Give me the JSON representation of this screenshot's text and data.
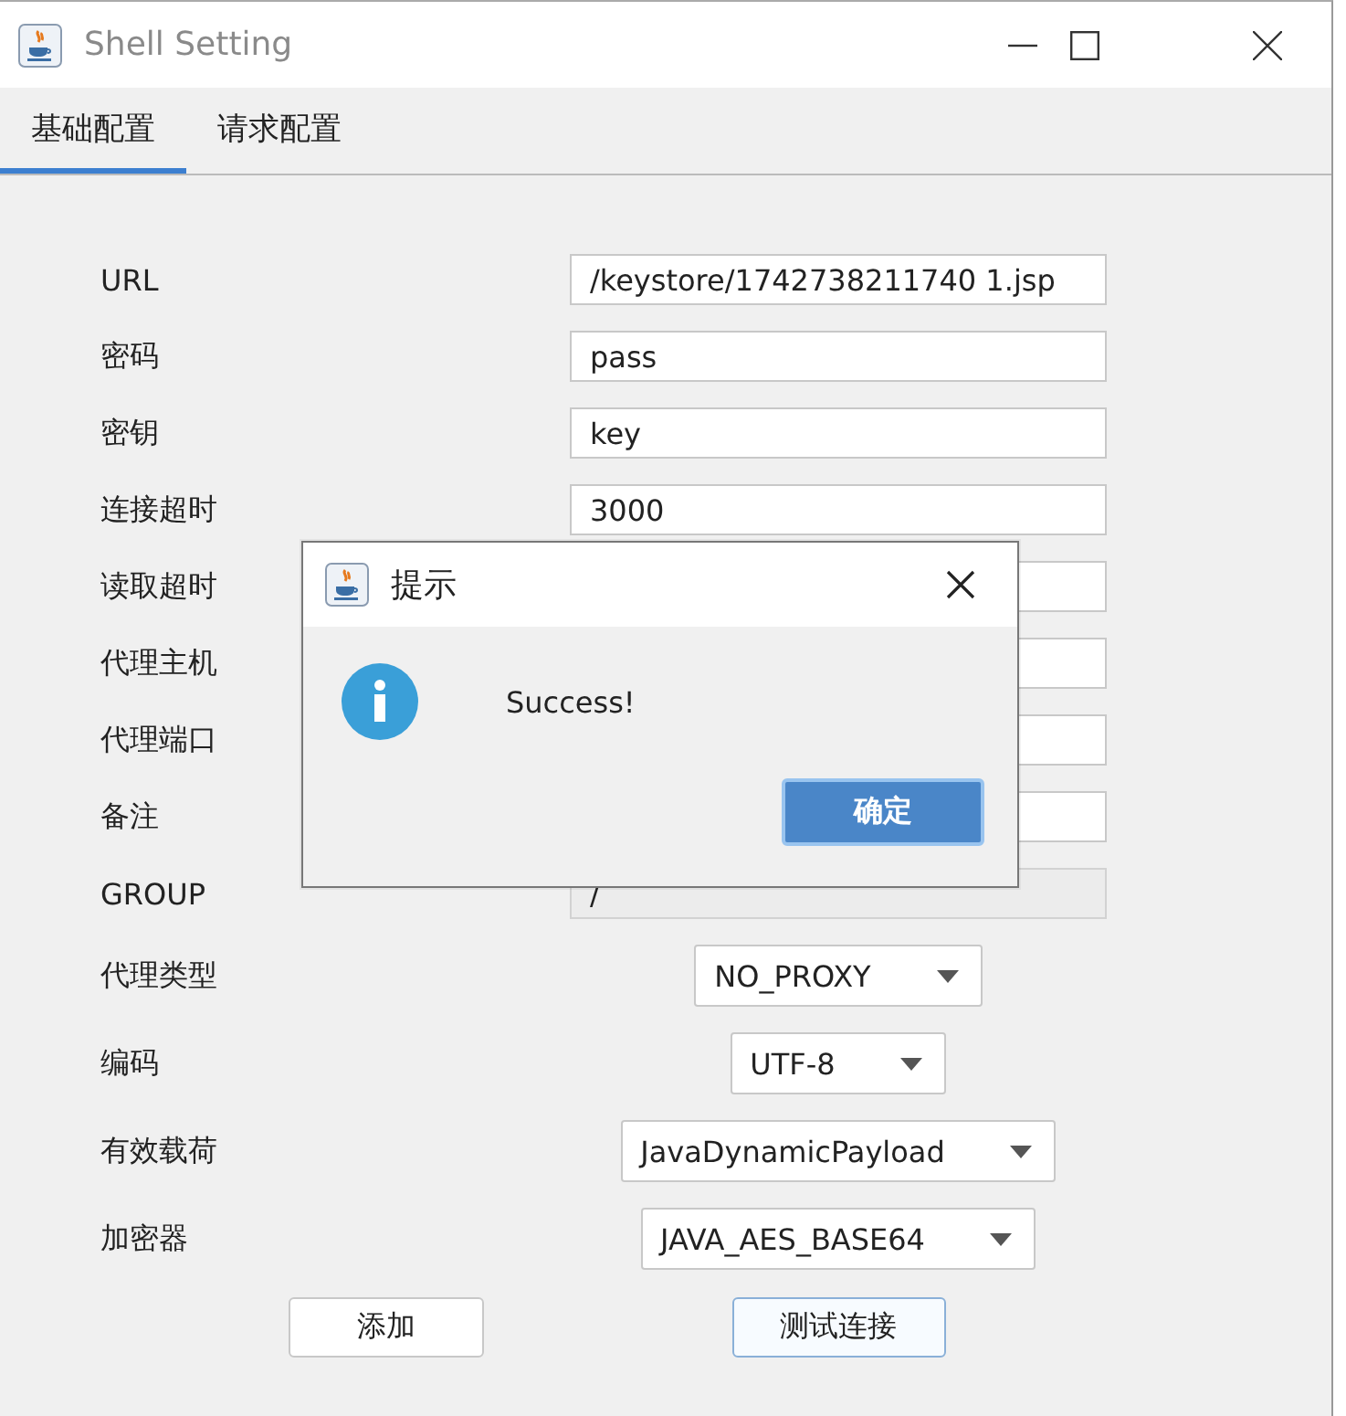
{
  "window": {
    "title": "Shell Setting"
  },
  "tabs": [
    {
      "label": "基础配置",
      "selected": true
    },
    {
      "label": "请求配置",
      "selected": false
    }
  ],
  "fields": [
    {
      "label": "URL",
      "value": "/keystore/1742738211740 1.jsp",
      "disabled": false
    },
    {
      "label": "密码",
      "value": "pass",
      "disabled": false
    },
    {
      "label": "密钥",
      "value": "key",
      "disabled": false
    },
    {
      "label": "连接超时",
      "value": "3000",
      "disabled": false
    },
    {
      "label": "读取超时",
      "disabled": false
    },
    {
      "label": "代理主机",
      "disabled": false
    },
    {
      "label": "代理端口",
      "disabled": false
    },
    {
      "label": "备注",
      "disabled": false
    },
    {
      "label": "GROUP",
      "value": "/",
      "disabled": true
    }
  ],
  "selects": [
    {
      "label": "代理类型",
      "value": "NO_PROXY"
    },
    {
      "label": "编码",
      "value": "UTF-8"
    },
    {
      "label": "有效载荷",
      "value": "JavaDynamicPayload"
    },
    {
      "label": "加密器",
      "value": "JAVA_AES_BASE64"
    }
  ],
  "buttons": [
    {
      "label": "添加",
      "focused": false
    },
    {
      "label": "测试连接",
      "focused": true
    }
  ],
  "dialog": {
    "title": "提示",
    "message": "Success!",
    "button": "确定"
  }
}
